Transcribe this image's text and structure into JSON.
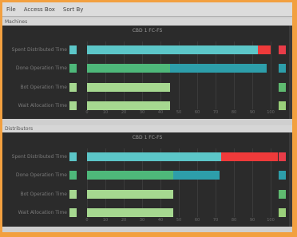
{
  "menu": [
    "File",
    "Access Box",
    "Sort By"
  ],
  "panels": [
    {
      "section_label": "Machines",
      "title": "CBD 1  FC-FS",
      "rows": [
        {
          "label": "Spent Distributed Time",
          "segments": [
            {
              "value": 93,
              "color": "#5cc6c8"
            },
            {
              "value": 7,
              "color": "#ef3a3a"
            }
          ],
          "indicator": "#5cc6c8",
          "right_indicator": "#e83c48"
        },
        {
          "label": "Done Operation Time",
          "segments": [
            {
              "value": 45,
              "color": "#4eb87a"
            },
            {
              "value": 53,
              "color": "#2d9eaa"
            }
          ],
          "indicator": "#4eb87a",
          "right_indicator": "#2d9eaa"
        },
        {
          "label": "Bot Operation Time",
          "segments": [
            {
              "value": 45,
              "color": "#a6d890"
            }
          ],
          "indicator": "#a6d890",
          "right_indicator": "#5fba70"
        },
        {
          "label": "Wait Allocation Time",
          "segments": [
            {
              "value": 45,
              "color": "#a6d890"
            }
          ],
          "indicator": "#a6d890",
          "right_indicator": "#9ad07a"
        }
      ]
    },
    {
      "section_label": "Distributors",
      "title": "CBD 1  FC-FS",
      "rows": [
        {
          "label": "Spent Distributed Time",
          "segments": [
            {
              "value": 73,
              "color": "#5cc6c8"
            },
            {
              "value": 35,
              "color": "#ef3a3a"
            }
          ],
          "indicator": "#5cc6c8",
          "right_indicator": "#e83c48"
        },
        {
          "label": "Done Operation Time",
          "segments": [
            {
              "value": 47,
              "color": "#4eb87a"
            },
            {
              "value": 25,
              "color": "#2d9eaa"
            }
          ],
          "indicator": "#4eb87a",
          "right_indicator": "#2d9eaa"
        },
        {
          "label": "Bot Operation Time",
          "segments": [
            {
              "value": 47,
              "color": "#a6d890"
            }
          ],
          "indicator": "#a6d890",
          "right_indicator": "#5fba70"
        },
        {
          "label": "Wait Allocation Time",
          "segments": [
            {
              "value": 47,
              "color": "#a6d890"
            }
          ],
          "indicator": "#a6d890",
          "right_indicator": "#9ad07a"
        }
      ]
    }
  ],
  "axis_ticks": [
    "0",
    "10",
    "20",
    "30",
    "40",
    "50",
    "60",
    "70",
    "80",
    "90",
    "100"
  ],
  "axis_max": 100
}
